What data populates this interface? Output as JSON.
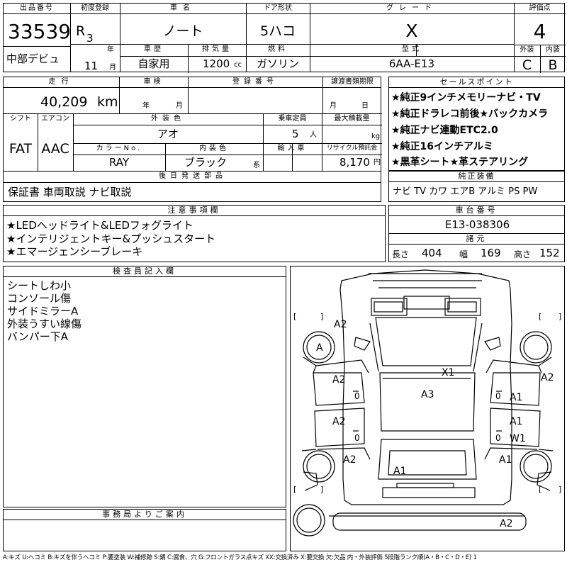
{
  "header": {
    "lot_number_label": "出品番号",
    "lot_number": "33539",
    "venue": "中部デビュ",
    "first_reg_label": "初度登録",
    "era": "R",
    "year": "3",
    "year_unit": "年",
    "month": "11",
    "month_unit": "月",
    "car_name_label": "車名",
    "car_name": "ノート",
    "door_label": "ドア形状",
    "door": "5ハコ",
    "grade_label": "グレード",
    "grade": "X",
    "score_label": "評価点",
    "score": "4",
    "history_label": "車歴",
    "history": "自家用",
    "displacement_label": "排気量",
    "displacement": "1200",
    "displacement_unit": "cc",
    "fuel_label": "燃料",
    "fuel": "ガソリン",
    "model_label": "型式",
    "model": "6AA-E13",
    "exterior_label": "外装",
    "exterior": "C",
    "interior_label": "内装",
    "interior": "B"
  },
  "mid": {
    "mileage_label": "走行",
    "mileage": "40,209",
    "mileage_unit": "km",
    "inspection_label": "車検",
    "insp_year_unit": "年",
    "insp_month_unit": "月",
    "plate_label": "登録番号",
    "transfer_label": "譲渡書類期限",
    "transfer_month_unit": "月",
    "transfer_day_unit": "日",
    "shift_label": "シフト",
    "shift": "FAT",
    "ac_label": "エアコン",
    "ac": "AAC",
    "color_label": "外装色",
    "color": "アオ",
    "capacity_label": "乗車定員",
    "capacity": "5",
    "capacity_unit": "人",
    "load_label": "最大積載量",
    "load_unit": "kg",
    "color_no_label": "カラーNo.",
    "color_no": "RAY",
    "int_color_label": "内装色",
    "int_color": "ブラック",
    "int_color_unit": "系",
    "import_label": "輸入車",
    "recycle_label": "リサイクル預託金",
    "recycle": "8,170",
    "recycle_unit": "円",
    "later_label": "後日発送部品",
    "later": "保証書 車両取説 ナビ取説"
  },
  "sales": {
    "label": "セールスポイント",
    "items": [
      "★純正9インチメモリーナビ・TV",
      "★純正ドラレコ前後★バックカメラ",
      "★純正ナビ連動ETC2.0",
      "★純正16インチアルミ",
      "★黒革シート★革ステアリング"
    ]
  },
  "equipment": {
    "label": "純正装備",
    "value": "ナビ TV カワ エアB アルミ PS PW"
  },
  "notes": {
    "label": "注意事項欄",
    "items": [
      "★LEDヘッドライト&LEDフォグライト",
      "★インテリジェントキー&プッシュスタート",
      "★エマージェンシーブレーキ"
    ]
  },
  "chassis": {
    "label": "車台番号",
    "value": "E13-038306"
  },
  "dims": {
    "label": "諸元",
    "length_label": "長さ",
    "length": "404",
    "width_label": "幅",
    "width": "169",
    "height_label": "高さ",
    "height": "152"
  },
  "inspector": {
    "label": "検査員記入欄",
    "items": [
      "シートしわ小",
      "コンソール傷",
      "サイドミラーA",
      "外装うすい線傷",
      "バンパー下A"
    ]
  },
  "office": {
    "label": "事務局よりご案内"
  },
  "diagram": {
    "marks": {
      "front_left_panel": "A2",
      "front_left_wheel": "A",
      "hood": "X1",
      "roof": "A3",
      "front_left_door": "A2",
      "front_left_door_sub": "0",
      "rear_left_door": "A2",
      "rear_left_door_sub": "0",
      "rear_left_panel": "A2",
      "front_right_panel": "A2",
      "front_right_door": "A1",
      "front_right_door_sub": "0",
      "rear_right_door_1": "A1",
      "rear_right_door_2": "W1",
      "rear_right_door_sub": "0",
      "rear_right_panel": "A1",
      "trunk": "A1",
      "rear_bumper": "A2"
    }
  },
  "legend": {
    "text": "A:キズ U:ヘコミ B:キズを伴うヘコミ P:要塗装 W:補修跡 S:錆 C:腐食、穴 G:フロントガラス点キズ XX:交換済み X:要交換 欠:欠品 内・外装評価 5段階ランク順(A・B・C・D・E) 1"
  }
}
